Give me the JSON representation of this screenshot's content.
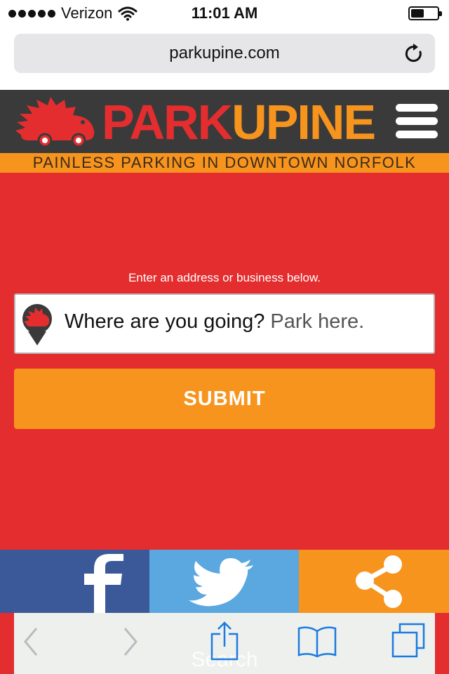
{
  "status_bar": {
    "carrier": "Verizon",
    "time": "11:01 AM"
  },
  "browser": {
    "url": "parkupine.com",
    "search_ghost": "Search"
  },
  "header": {
    "logo_part1": "PARK",
    "logo_part2": "UPINE",
    "tagline": "PAINLESS PARKING IN DOWNTOWN NORFOLK"
  },
  "main": {
    "instructions": "Enter an address or business below.",
    "search_value": "Where are you going?",
    "search_placeholder": "Park here.",
    "submit_label": "SUBMIT"
  },
  "social": {
    "icons": [
      "facebook-icon",
      "twitter-icon",
      "share-icon"
    ]
  },
  "toolbar": {
    "icons": [
      "back-icon",
      "forward-icon",
      "share-icon",
      "bookmarks-icon",
      "tabs-icon"
    ]
  },
  "colors": {
    "red": "#e42d2f",
    "orange": "#f7941d",
    "dark": "#3a3a3a",
    "facebook": "#3b5998",
    "twitter": "#5aa8df"
  }
}
